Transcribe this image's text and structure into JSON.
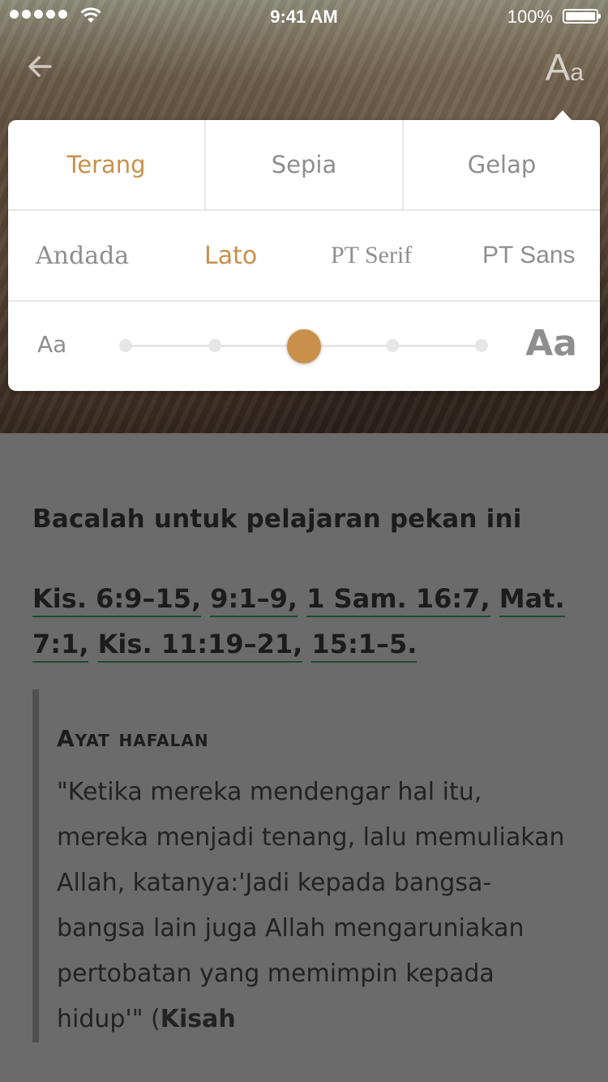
{
  "status_bar": {
    "time": "9:41 AM",
    "battery_percent": "100%",
    "signal_bars": 5
  },
  "nav": {
    "back_icon": "back-arrow-icon",
    "font_button_big": "A",
    "font_button_small": "a"
  },
  "settings": {
    "themes": [
      "Terang",
      "Sepia",
      "Gelap"
    ],
    "selected_theme": "Terang",
    "fonts": [
      "Andada",
      "Lato",
      "PT Serif",
      "PT Sans"
    ],
    "selected_font": "Lato",
    "size_small_label": "Aa",
    "size_large_label": "Aa",
    "size_steps": 5,
    "size_selected_index": 2,
    "accent_color": "#c8904a"
  },
  "content": {
    "heading": "Bacalah untuk pelajaran pekan ini",
    "references": [
      "Kis. 6:9–15,",
      "9:1–9,",
      "1 Sam. 16:7,",
      "Mat. 7:1,",
      "Kis. 11:19–21,",
      "15:1–5."
    ],
    "memory_heading": "Ayat hafalan",
    "memory_verse": "\"Ketika mereka mendengar hal itu, mereka menjadi tenang, lalu memuliakan Allah, katanya:'Jadi kepada bangsa-bangsa lain juga Allah mengaruniakan pertobatan yang memimpin kepada hidup'\"",
    "memory_ref": "Kisah"
  }
}
